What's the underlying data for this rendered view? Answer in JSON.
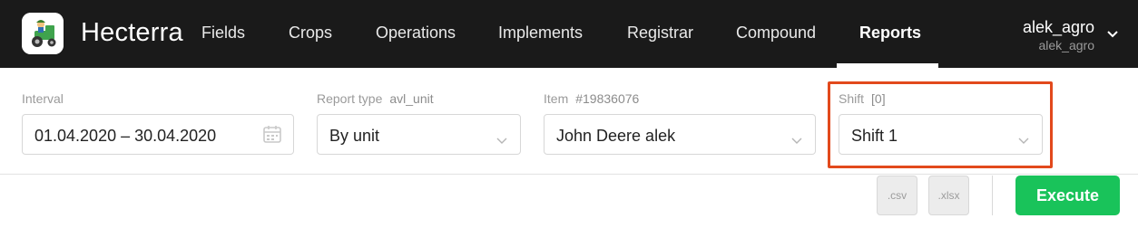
{
  "app": {
    "brand": "Hecterra",
    "logo_icon": "tractor-logo-icon"
  },
  "nav": {
    "items": [
      {
        "label": "Fields"
      },
      {
        "label": "Crops"
      },
      {
        "label": "Operations"
      },
      {
        "label": "Implements"
      },
      {
        "label": "Registrar"
      },
      {
        "label": "Compound"
      },
      {
        "label": "Reports"
      }
    ],
    "active": "Reports"
  },
  "user": {
    "name": "alek_agro",
    "account": "alek_agro"
  },
  "filters": {
    "interval": {
      "label": "Interval",
      "value": "01.04.2020 – 30.04.2020"
    },
    "report_type": {
      "label": "Report type",
      "extra": "avl_unit",
      "value": "By unit"
    },
    "item": {
      "label": "Item",
      "extra": "#19836076",
      "value": "John Deere alek"
    },
    "shift": {
      "label": "Shift",
      "extra": "[0]",
      "value": "Shift 1"
    }
  },
  "actions": {
    "csv_label": ".csv",
    "xlsx_label": ".xlsx",
    "execute_label": "Execute"
  },
  "colors": {
    "topbar": "#1a1a1a",
    "execute": "#19c35a",
    "highlight": "#e2491c"
  }
}
